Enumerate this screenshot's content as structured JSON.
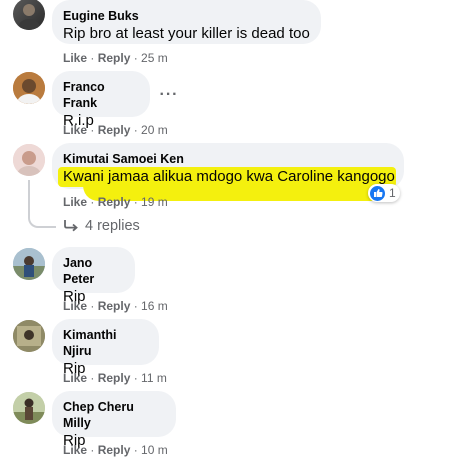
{
  "comments": [
    {
      "author": "Eugine Buks",
      "text": "Rip bro at least your killer is dead too",
      "like": "Like",
      "reply": "Reply",
      "time": "25 m"
    },
    {
      "author": "Franco Frank",
      "text": "R.i.p",
      "like": "Like",
      "reply": "Reply",
      "time": "20 m"
    },
    {
      "author": "Kimutai Samoei Ken",
      "text": "Kwani jamaa alikua mdogo kwa Caroline kangogo",
      "like": "Like",
      "reply": "Reply",
      "time": "19 m",
      "reaction_count": "1",
      "replies_label": "4 replies"
    },
    {
      "author": "Jano Peter",
      "text": "Rip",
      "like": "Like",
      "reply": "Reply",
      "time": "16 m"
    },
    {
      "author": "Kimanthi Njiru",
      "text": "Rip",
      "like": "Like",
      "reply": "Reply",
      "time": "11 m"
    },
    {
      "author": "Chep Cheru Milly",
      "text": "Rip",
      "like": "Like",
      "reply": "Reply",
      "time": "10 m"
    }
  ],
  "more_options_icon": "ellipsis-icon",
  "colors": {
    "bubble": "#f0f2f5",
    "meta_text": "#65676b",
    "like_blue": "#1877f2",
    "highlight": "#f4f00e"
  }
}
